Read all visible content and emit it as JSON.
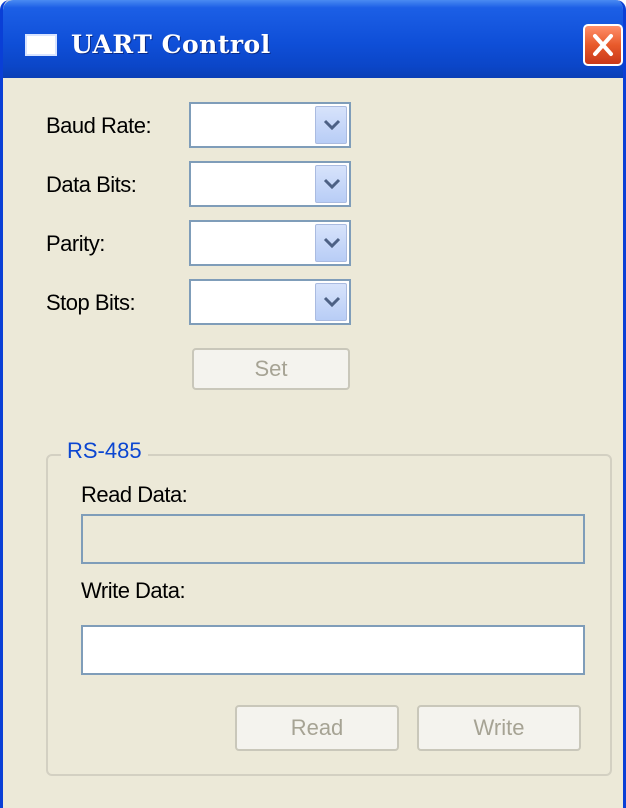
{
  "window": {
    "title": "UART Control",
    "icon": "window-app-icon",
    "close_icon": "close-icon"
  },
  "settings": {
    "baud_rate_label": "Baud Rate:",
    "data_bits_label": "Data Bits:",
    "parity_label": "Parity:",
    "stop_bits_label": "Stop Bits:",
    "baud_rate_value": "",
    "data_bits_value": "",
    "parity_value": "",
    "stop_bits_value": "",
    "dropdown_icon": "chevron-down-icon",
    "set_label": "Set"
  },
  "rs485": {
    "group_title": "RS-485",
    "read_data_label": "Read Data:",
    "read_data_value": "",
    "write_data_label": "Write Data:",
    "write_data_value": "",
    "read_label": "Read",
    "write_label": "Write"
  },
  "colors": {
    "window_bg": "#ece9d8",
    "titlebar": "#0f4fd8",
    "group_title": "#0b46d1",
    "disabled_text": "#a6a394",
    "close_button": "#e85a2b"
  }
}
